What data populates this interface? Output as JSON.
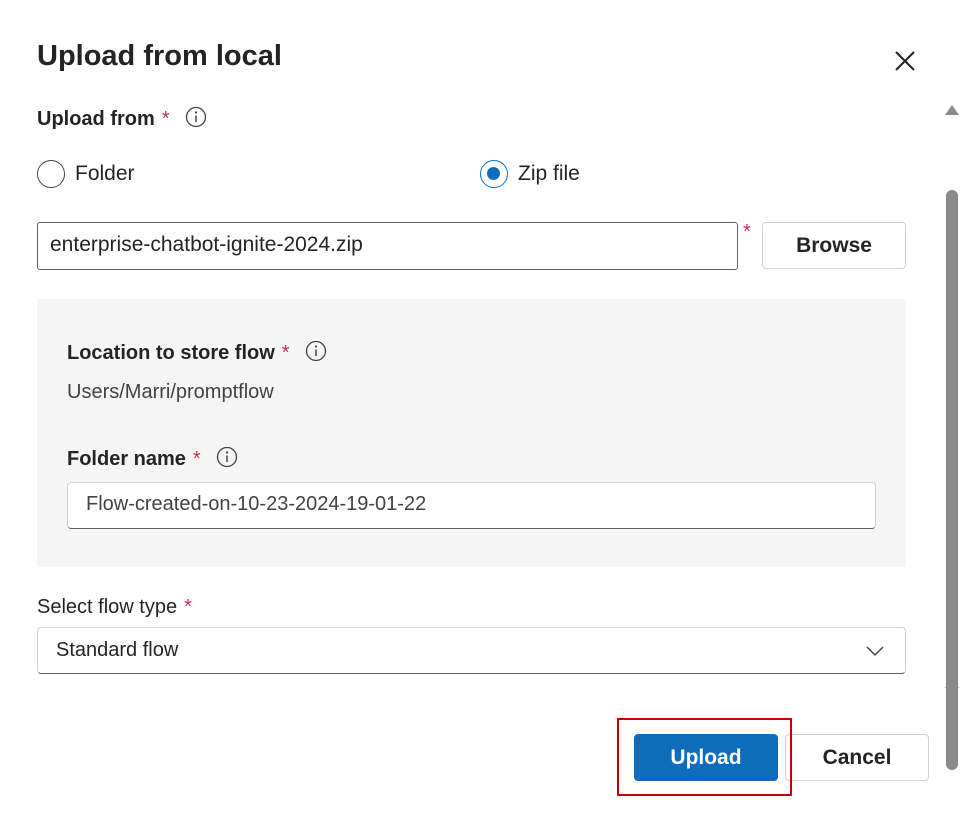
{
  "dialog": {
    "title": "Upload from local",
    "close_icon": "close-icon"
  },
  "upload_from": {
    "label": "Upload from",
    "required_mark": "*",
    "info_icon": "info-icon",
    "options": [
      {
        "label": "Folder",
        "selected": false
      },
      {
        "label": "Zip file",
        "selected": true
      }
    ]
  },
  "file": {
    "value": "enterprise-chatbot-ignite-2024.zip",
    "required_mark": "*",
    "browse_label": "Browse"
  },
  "location": {
    "label": "Location to store flow",
    "required_mark": "*",
    "info_icon": "info-icon",
    "value": "Users/Marri/promptflow"
  },
  "folder_name": {
    "label": "Folder name",
    "required_mark": "*",
    "info_icon": "info-icon",
    "value": "Flow-created-on-10-23-2024-19-01-22"
  },
  "flow_type": {
    "label": "Select flow type",
    "required_mark": "*",
    "selected": "Standard flow",
    "chevron_icon": "chevron-down-icon"
  },
  "footer": {
    "upload_label": "Upload",
    "cancel_label": "Cancel"
  },
  "colors": {
    "accent": "#0f6cbd",
    "required": "#c4314b",
    "highlight": "#c00000"
  }
}
